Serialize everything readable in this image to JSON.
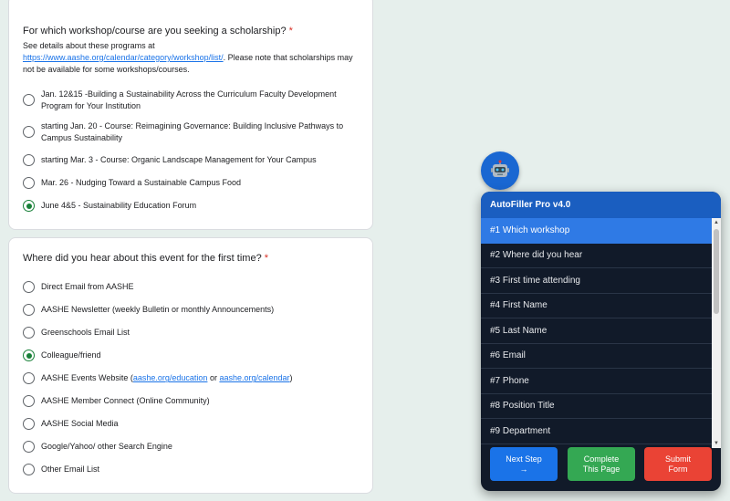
{
  "q1": {
    "title": "For which workshop/course are you seeking a scholarship?",
    "required_mark": "*",
    "desc_before": "See details about these programs at",
    "desc_link": "https://www.aashe.org/calendar/category/workshop/list/",
    "desc_after": ". Please note that scholarships may not be available for some workshops/courses.",
    "options": [
      "Jan. 12&15 -Building a Sustainability Across the Curriculum Faculty Development Program for Your Institution",
      "starting Jan. 20 - Course: Reimagining Governance: Building Inclusive Pathways to Campus Sustainability",
      "starting Mar. 3 - Course: Organic Landscape Management for Your Campus",
      "Mar. 26 - Nudging Toward a Sustainable Campus Food",
      "June 4&5 - Sustainability Education Forum"
    ],
    "selected": "June 4&5 - Sustainability Education Forum"
  },
  "q2": {
    "title": "Where did you hear about this event for the first time?",
    "required_mark": "*",
    "options": [
      "Direct Email from AASHE",
      "AASHE Newsletter (weekly Bulletin or monthly Announcements)",
      "Greenschools Email List",
      "Colleague/friend",
      "AASHE Events Website (",
      "AASHE Member Connect (Online Community)",
      "AASHE Social Media",
      "Google/Yahoo/ other Search Engine",
      "Other Email List"
    ],
    "events_link1": "aashe.org/education",
    "events_or": " or ",
    "events_link2": "aashe.org/calendar",
    "events_close": ")",
    "selected": "Colleague/friend"
  },
  "robot": {
    "icon": "robot-icon",
    "glyph": "🤖"
  },
  "panel": {
    "title": "AutoFiller Pro v4.0",
    "items": [
      "#1 Which workshop",
      "#2 Where did you hear",
      "#3 First time attending",
      "#4 First Name",
      "#5 Last Name",
      "#6 Email",
      "#7 Phone",
      "#8 Position Title",
      "#9 Department"
    ],
    "active_index": 0,
    "buttons": {
      "next": "Next Step\n→",
      "complete": "Complete\nThis Page",
      "submit": "Submit\nForm"
    }
  },
  "colors": {
    "page_bg": "#e6efec",
    "selected_radio": "#188038",
    "link": "#1a73e8",
    "required": "#d93025",
    "panel_bg": "#111a29",
    "panel_header": "#1a5ec0",
    "active_item": "#2f7ae5",
    "next_button": "#1a73e8",
    "complete_button": "#34a853",
    "submit_button": "#ea4335"
  }
}
